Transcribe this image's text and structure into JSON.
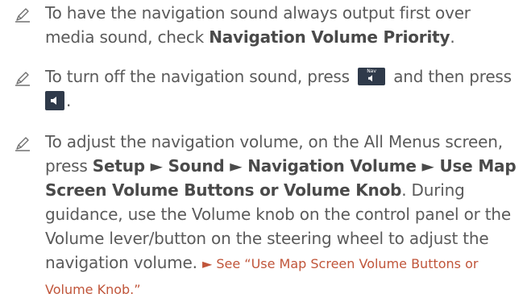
{
  "notes": [
    {
      "parts": [
        "To have the navigation sound always output first over media sound, check ",
        "Navigation Volume Priority",
        "."
      ]
    },
    {
      "parts": [
        "To turn off the navigation sound, press ",
        " and then press ",
        "."
      ],
      "nav_button_label": "Nav"
    },
    {
      "parts": [
        "To adjust the navigation volume, on the All Menus screen, press ",
        "Setup ► Sound ► Navigation Volume ► Use Map Screen Volume Buttons or Volume Knob",
        ". During guidance, use the Volume knob on the control panel or the Volume lever/button on the steering wheel to adjust the navigation volume. "
      ],
      "link": "► See “Use Map Screen Volume Buttons or Volume Knob.”"
    }
  ],
  "icons": {
    "note": "pencil-icon",
    "nav_button": "nav-speaker-icon",
    "mute_button": "speaker-icon"
  },
  "colors": {
    "text": "#5a5a5a",
    "button_bg": "#2f3a4a",
    "link": "#c0553a"
  }
}
